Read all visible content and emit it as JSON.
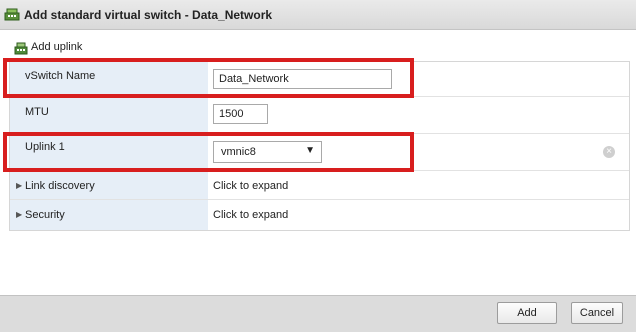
{
  "dialog": {
    "title": "Add standard virtual switch - Data_Network",
    "title_icon": "virtual-switch-icon"
  },
  "toolbar": {
    "add_uplink_label": "Add uplink",
    "add_uplink_icon": "add-uplink-icon"
  },
  "form": {
    "vswitch_name": {
      "label": "vSwitch Name",
      "value": "Data_Network"
    },
    "mtu": {
      "label": "MTU",
      "value": "1500"
    },
    "uplink1": {
      "label": "Uplink 1",
      "selected": "vmnic8",
      "remove_icon": "remove-circle-icon"
    },
    "link_discovery": {
      "label": "Link discovery",
      "value": "Click to expand",
      "icon": "expand-triangle-icon"
    },
    "security": {
      "label": "Security",
      "value": "Click to expand",
      "icon": "expand-triangle-icon"
    }
  },
  "footer": {
    "add_label": "Add",
    "cancel_label": "Cancel"
  },
  "colors": {
    "highlight": "#d81e1e",
    "label_bg": "#e6eef7",
    "footer_bg": "#dcdcdc"
  }
}
